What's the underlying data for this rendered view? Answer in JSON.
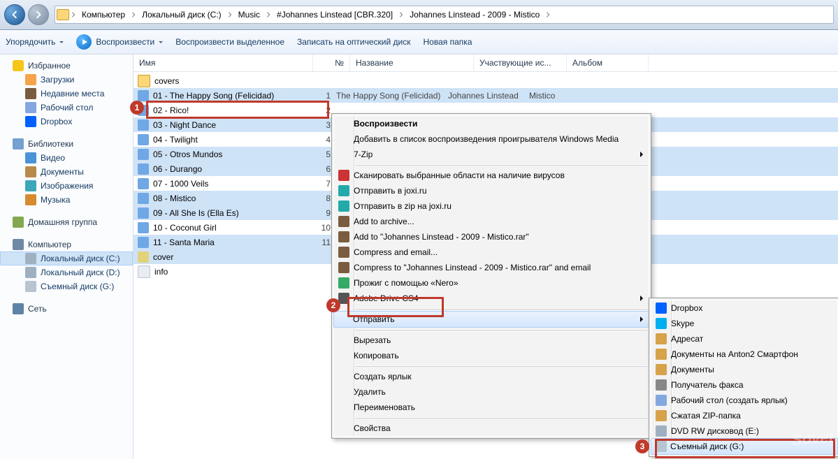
{
  "breadcrumbs": [
    "Компьютер",
    "Локальный диск (C:)",
    "Music",
    "#Johannes Linstead [CBR.320]",
    "Johannes Linstead - 2009 - Mistico"
  ],
  "toolbar": {
    "organize": "Упорядочить",
    "play": "Воспроизвести",
    "play_sel": "Воспроизвести выделенное",
    "burn": "Записать на оптический диск",
    "new_folder": "Новая папка"
  },
  "columns": {
    "name": "Имя",
    "num": "№",
    "title": "Название",
    "artist": "Участвующие ис...",
    "album": "Альбом"
  },
  "sidebar": {
    "favorites": {
      "label": "Избранное",
      "items": [
        {
          "label": "Загрузки",
          "icon": "i-dl"
        },
        {
          "label": "Недавние места",
          "icon": "i-recent"
        },
        {
          "label": "Рабочий стол",
          "icon": "i-desk"
        },
        {
          "label": "Dropbox",
          "icon": "i-dropbox"
        }
      ]
    },
    "libraries": {
      "label": "Библиотеки",
      "items": [
        {
          "label": "Видео",
          "icon": "i-vid"
        },
        {
          "label": "Документы",
          "icon": "i-doc"
        },
        {
          "label": "Изображения",
          "icon": "i-img"
        },
        {
          "label": "Музыка",
          "icon": "i-mus"
        }
      ]
    },
    "homegroup": {
      "label": "Домашняя группа"
    },
    "computer": {
      "label": "Компьютер",
      "items": [
        {
          "label": "Локальный диск (C:)",
          "icon": "i-disk",
          "sel": true
        },
        {
          "label": "Локальный диск (D:)",
          "icon": "i-disk"
        },
        {
          "label": "Съемный диск (G:)",
          "icon": "i-usb"
        }
      ]
    },
    "network": {
      "label": "Сеть"
    }
  },
  "files": [
    {
      "type": "folder",
      "name": "covers"
    },
    {
      "type": "music",
      "name": "01 - The Happy Song (Felicidad)",
      "num": "1",
      "title": "The Happy Song (Felicidad)",
      "artist": "Johannes Linstead",
      "album": "Mistico",
      "sel": true
    },
    {
      "type": "music",
      "name": "02 - Rico!",
      "num": "2"
    },
    {
      "type": "music",
      "name": "03 - Night Dance",
      "num": "3",
      "sel": true
    },
    {
      "type": "music",
      "name": "04 - Twilight",
      "num": "4"
    },
    {
      "type": "music",
      "name": "05 - Otros Mundos",
      "num": "5",
      "sel": true
    },
    {
      "type": "music",
      "name": "06 - Durango",
      "num": "6",
      "sel": true
    },
    {
      "type": "music",
      "name": "07 - 1000 Veils",
      "num": "7"
    },
    {
      "type": "music",
      "name": "08 - Mistico",
      "num": "8",
      "sel": true
    },
    {
      "type": "music",
      "name": "09 - All She Is (Ella Es)",
      "num": "9",
      "sel": true
    },
    {
      "type": "music",
      "name": "10 - Coconut Girl",
      "num": "10"
    },
    {
      "type": "music",
      "name": "11 - Santa Maria",
      "num": "11",
      "sel": true
    },
    {
      "type": "image",
      "name": "cover",
      "sel": true
    },
    {
      "type": "text",
      "name": "info"
    }
  ],
  "ctx1": [
    {
      "label": "Воспроизвести",
      "bold": true
    },
    {
      "label": "Добавить в список воспроизведения проигрывателя Windows Media"
    },
    {
      "label": "7-Zip",
      "arrow": true
    },
    {
      "sep": true
    },
    {
      "label": "Сканировать выбранные области на наличие вирусов",
      "icon": "#c33"
    },
    {
      "label": "Отправить в joxi.ru",
      "icon": "#2aa"
    },
    {
      "label": "Отправить в zip на joxi.ru",
      "icon": "#2aa"
    },
    {
      "label": "Add to archive...",
      "icon": "#7a5c3e"
    },
    {
      "label": "Add to \"Johannes Linstead - 2009 - Mistico.rar\"",
      "icon": "#7a5c3e"
    },
    {
      "label": "Compress and email...",
      "icon": "#7a5c3e"
    },
    {
      "label": "Compress to \"Johannes Linstead - 2009 - Mistico.rar\" and email",
      "icon": "#7a5c3e"
    },
    {
      "label": "Прожиг с помощью «Nero»",
      "icon": "#3a6"
    },
    {
      "label": "Adobe Drive CS4",
      "icon": "#555",
      "arrow": true
    },
    {
      "sep": true
    },
    {
      "label": "Отправить",
      "arrow": true,
      "hov": true
    },
    {
      "sep": true
    },
    {
      "label": "Вырезать"
    },
    {
      "label": "Копировать"
    },
    {
      "sep": true
    },
    {
      "label": "Создать ярлык"
    },
    {
      "label": "Удалить"
    },
    {
      "label": "Переименовать"
    },
    {
      "sep": true
    },
    {
      "label": "Свойства"
    }
  ],
  "ctx2": [
    {
      "label": "Dropbox",
      "icon": "#0061fe"
    },
    {
      "label": "Skype",
      "icon": "#00aff0"
    },
    {
      "label": "Адресат",
      "icon": "#d6a24a"
    },
    {
      "label": "Документы на Anton2 Смартфон",
      "icon": "#d6a24a"
    },
    {
      "label": "Документы",
      "icon": "#d6a24a"
    },
    {
      "label": "Получатель факса",
      "icon": "#888"
    },
    {
      "label": "Рабочий стол (создать ярлык)",
      "icon": "#84a7e0"
    },
    {
      "label": "Сжатая ZIP-папка",
      "icon": "#d6a24a"
    },
    {
      "label": "DVD RW дисковод (E:)",
      "icon": "#9fb0c1"
    },
    {
      "label": "Съемный диск (G:)",
      "icon": "#b7c4d2",
      "hov": true
    }
  ],
  "badges": {
    "b1": "1",
    "b2": "2",
    "b3": "3"
  },
  "watermark": "Sovet"
}
